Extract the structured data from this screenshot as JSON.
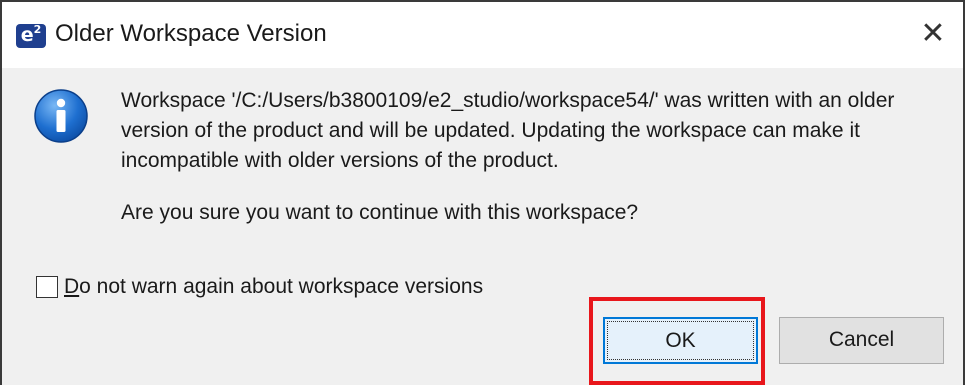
{
  "window": {
    "title": "Older Workspace Version",
    "app_icon_text": "e",
    "app_icon_sup": "2",
    "close_glyph": "✕"
  },
  "message": {
    "body": "Workspace '/C:/Users/b3800109/e2_studio/workspace54/' was written with an older\nversion of the product and will be updated. Updating the workspace can make it\nincompatible with older versions of the product.",
    "question": "Are you sure you want to continue with this workspace?",
    "icon": "info-icon"
  },
  "checkbox": {
    "mnemonic": "D",
    "label_rest": "o not warn again about workspace versions",
    "checked": false
  },
  "buttons": {
    "ok_label": "OK",
    "cancel_label": "Cancel"
  },
  "colors": {
    "highlight": "#e8161b",
    "default_button_border": "#0078d7",
    "info_icon": "#1e6fd0"
  }
}
